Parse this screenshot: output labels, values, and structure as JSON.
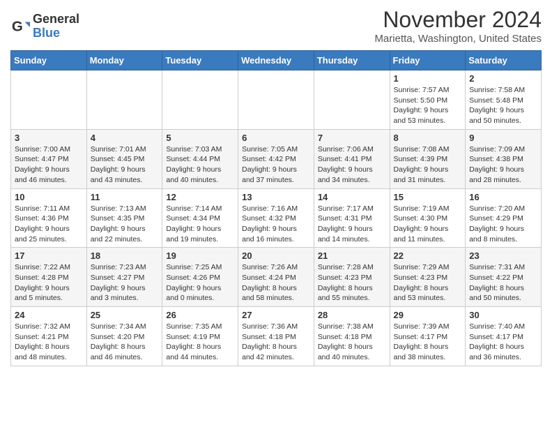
{
  "logo": {
    "text_general": "General",
    "text_blue": "Blue"
  },
  "title": "November 2024",
  "location": "Marietta, Washington, United States",
  "days_of_week": [
    "Sunday",
    "Monday",
    "Tuesday",
    "Wednesday",
    "Thursday",
    "Friday",
    "Saturday"
  ],
  "weeks": [
    [
      {
        "day": "",
        "info": ""
      },
      {
        "day": "",
        "info": ""
      },
      {
        "day": "",
        "info": ""
      },
      {
        "day": "",
        "info": ""
      },
      {
        "day": "",
        "info": ""
      },
      {
        "day": "1",
        "info": "Sunrise: 7:57 AM\nSunset: 5:50 PM\nDaylight: 9 hours and 53 minutes."
      },
      {
        "day": "2",
        "info": "Sunrise: 7:58 AM\nSunset: 5:48 PM\nDaylight: 9 hours and 50 minutes."
      }
    ],
    [
      {
        "day": "3",
        "info": "Sunrise: 7:00 AM\nSunset: 4:47 PM\nDaylight: 9 hours and 46 minutes."
      },
      {
        "day": "4",
        "info": "Sunrise: 7:01 AM\nSunset: 4:45 PM\nDaylight: 9 hours and 43 minutes."
      },
      {
        "day": "5",
        "info": "Sunrise: 7:03 AM\nSunset: 4:44 PM\nDaylight: 9 hours and 40 minutes."
      },
      {
        "day": "6",
        "info": "Sunrise: 7:05 AM\nSunset: 4:42 PM\nDaylight: 9 hours and 37 minutes."
      },
      {
        "day": "7",
        "info": "Sunrise: 7:06 AM\nSunset: 4:41 PM\nDaylight: 9 hours and 34 minutes."
      },
      {
        "day": "8",
        "info": "Sunrise: 7:08 AM\nSunset: 4:39 PM\nDaylight: 9 hours and 31 minutes."
      },
      {
        "day": "9",
        "info": "Sunrise: 7:09 AM\nSunset: 4:38 PM\nDaylight: 9 hours and 28 minutes."
      }
    ],
    [
      {
        "day": "10",
        "info": "Sunrise: 7:11 AM\nSunset: 4:36 PM\nDaylight: 9 hours and 25 minutes."
      },
      {
        "day": "11",
        "info": "Sunrise: 7:13 AM\nSunset: 4:35 PM\nDaylight: 9 hours and 22 minutes."
      },
      {
        "day": "12",
        "info": "Sunrise: 7:14 AM\nSunset: 4:34 PM\nDaylight: 9 hours and 19 minutes."
      },
      {
        "day": "13",
        "info": "Sunrise: 7:16 AM\nSunset: 4:32 PM\nDaylight: 9 hours and 16 minutes."
      },
      {
        "day": "14",
        "info": "Sunrise: 7:17 AM\nSunset: 4:31 PM\nDaylight: 9 hours and 14 minutes."
      },
      {
        "day": "15",
        "info": "Sunrise: 7:19 AM\nSunset: 4:30 PM\nDaylight: 9 hours and 11 minutes."
      },
      {
        "day": "16",
        "info": "Sunrise: 7:20 AM\nSunset: 4:29 PM\nDaylight: 9 hours and 8 minutes."
      }
    ],
    [
      {
        "day": "17",
        "info": "Sunrise: 7:22 AM\nSunset: 4:28 PM\nDaylight: 9 hours and 5 minutes."
      },
      {
        "day": "18",
        "info": "Sunrise: 7:23 AM\nSunset: 4:27 PM\nDaylight: 9 hours and 3 minutes."
      },
      {
        "day": "19",
        "info": "Sunrise: 7:25 AM\nSunset: 4:26 PM\nDaylight: 9 hours and 0 minutes."
      },
      {
        "day": "20",
        "info": "Sunrise: 7:26 AM\nSunset: 4:24 PM\nDaylight: 8 hours and 58 minutes."
      },
      {
        "day": "21",
        "info": "Sunrise: 7:28 AM\nSunset: 4:23 PM\nDaylight: 8 hours and 55 minutes."
      },
      {
        "day": "22",
        "info": "Sunrise: 7:29 AM\nSunset: 4:23 PM\nDaylight: 8 hours and 53 minutes."
      },
      {
        "day": "23",
        "info": "Sunrise: 7:31 AM\nSunset: 4:22 PM\nDaylight: 8 hours and 50 minutes."
      }
    ],
    [
      {
        "day": "24",
        "info": "Sunrise: 7:32 AM\nSunset: 4:21 PM\nDaylight: 8 hours and 48 minutes."
      },
      {
        "day": "25",
        "info": "Sunrise: 7:34 AM\nSunset: 4:20 PM\nDaylight: 8 hours and 46 minutes."
      },
      {
        "day": "26",
        "info": "Sunrise: 7:35 AM\nSunset: 4:19 PM\nDaylight: 8 hours and 44 minutes."
      },
      {
        "day": "27",
        "info": "Sunrise: 7:36 AM\nSunset: 4:18 PM\nDaylight: 8 hours and 42 minutes."
      },
      {
        "day": "28",
        "info": "Sunrise: 7:38 AM\nSunset: 4:18 PM\nDaylight: 8 hours and 40 minutes."
      },
      {
        "day": "29",
        "info": "Sunrise: 7:39 AM\nSunset: 4:17 PM\nDaylight: 8 hours and 38 minutes."
      },
      {
        "day": "30",
        "info": "Sunrise: 7:40 AM\nSunset: 4:17 PM\nDaylight: 8 hours and 36 minutes."
      }
    ]
  ]
}
